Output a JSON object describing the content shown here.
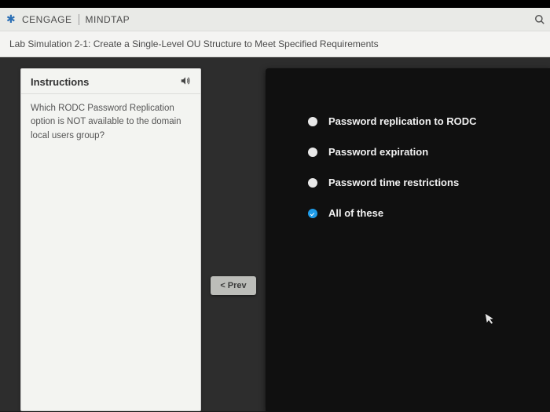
{
  "brand": {
    "cengage": "CENGAGE",
    "mindtap": "MINDTAP"
  },
  "subheader": "Lab Simulation 2-1: Create a Single-Level OU Structure to Meet Specified Requirements",
  "instructions": {
    "title": "Instructions",
    "question": "Which RODC Password Replication option is NOT available to the domain local users group?"
  },
  "nav": {
    "prev": "< Prev"
  },
  "options": [
    {
      "label": "Password replication to RODC",
      "selected": false
    },
    {
      "label": "Password expiration",
      "selected": false
    },
    {
      "label": "Password time restrictions",
      "selected": false
    },
    {
      "label": "All of these",
      "selected": true
    }
  ]
}
